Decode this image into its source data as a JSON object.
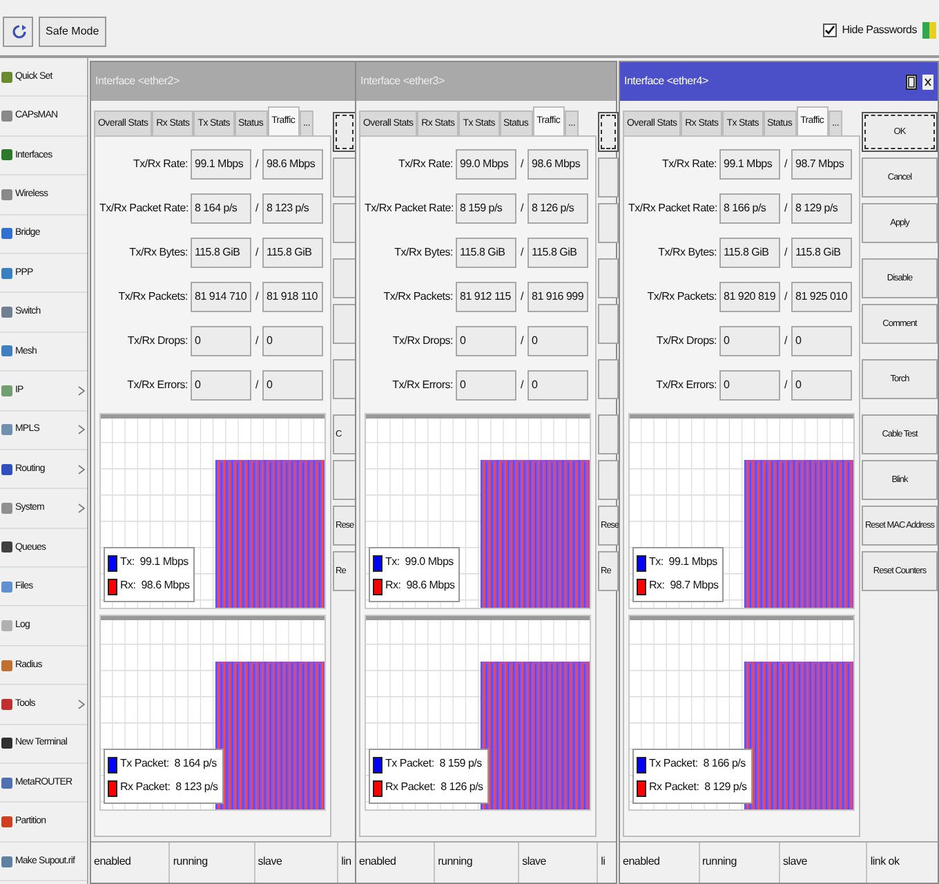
{
  "toolbar": {
    "safe_mode": "Safe Mode",
    "hide_passwords": {
      "label": "Hide Passwords",
      "checked": true
    }
  },
  "sidebar": {
    "items": [
      {
        "label": "Quick Set",
        "submenu": false
      },
      {
        "label": "CAPsMAN",
        "submenu": false
      },
      {
        "label": "Interfaces",
        "submenu": false
      },
      {
        "label": "Wireless",
        "submenu": false
      },
      {
        "label": "Bridge",
        "submenu": false
      },
      {
        "label": "PPP",
        "submenu": false
      },
      {
        "label": "Switch",
        "submenu": false
      },
      {
        "label": "Mesh",
        "submenu": false
      },
      {
        "label": "IP",
        "submenu": true
      },
      {
        "label": "MPLS",
        "submenu": true
      },
      {
        "label": "Routing",
        "submenu": true
      },
      {
        "label": "System",
        "submenu": true
      },
      {
        "label": "Queues",
        "submenu": false
      },
      {
        "label": "Files",
        "submenu": false
      },
      {
        "label": "Log",
        "submenu": false
      },
      {
        "label": "Radius",
        "submenu": false
      },
      {
        "label": "Tools",
        "submenu": true
      },
      {
        "label": "New Terminal",
        "submenu": false
      },
      {
        "label": "MetaROUTER",
        "submenu": false
      },
      {
        "label": "Partition",
        "submenu": false
      },
      {
        "label": "Make Supout.rif",
        "submenu": false
      }
    ]
  },
  "windows": [
    {
      "title": "Interface <ether2>",
      "active": false,
      "tabs": [
        {
          "label": "Overall Stats",
          "selected": false
        },
        {
          "label": "Rx Stats",
          "selected": false
        },
        {
          "label": "Tx Stats",
          "selected": false
        },
        {
          "label": "Status",
          "selected": false
        },
        {
          "label": "Traffic",
          "selected": true
        },
        {
          "label": "...",
          "selected": false
        }
      ],
      "fields": [
        {
          "label": "Tx/Rx Rate:",
          "tx": "99.1 Mbps",
          "separator": "/",
          "rx": "98.6 Mbps"
        },
        {
          "label": "Tx/Rx Packet Rate:",
          "tx": "8 164 p/s",
          "separator": "/",
          "rx": "8 123 p/s"
        },
        {
          "label": "Tx/Rx Bytes:",
          "tx": "115.8 GiB",
          "separator": "/",
          "rx": "115.8 GiB"
        },
        {
          "label": "Tx/Rx Packets:",
          "tx": "81 914 710",
          "separator": "/",
          "rx": "81 918 110"
        },
        {
          "label": "Tx/Rx Drops:",
          "tx": "0",
          "separator": "/",
          "rx": "0"
        },
        {
          "label": "Tx/Rx Errors:",
          "tx": "0",
          "separator": "/",
          "rx": "0"
        }
      ],
      "graphs": [
        {
          "legend": [
            {
              "label": "Tx:  99.1 Mbps",
              "color": "#0000ff"
            },
            {
              "label": "Rx:  98.6 Mbps",
              "color": "#ff0000"
            }
          ]
        },
        {
          "legend": [
            {
              "label": "Tx Packet:  8 164 p/s",
              "color": "#0000ff"
            },
            {
              "label": "Rx Packet:  8 123 p/s",
              "color": "#ff0000"
            }
          ]
        }
      ],
      "button_groups": [
        [
          {
            "focused": true
          },
          {
            "focused": false
          },
          {
            "focused": false
          }
        ],
        [
          {
            "focused": false
          },
          {
            "focused": false
          }
        ],
        [
          {
            "focused": false
          }
        ],
        [
          {
            "label": "C",
            "focused": false
          },
          {
            "focused": false
          },
          {
            "label": "Rese",
            "focused": false
          },
          {
            "label": "Re",
            "focused": false
          }
        ]
      ],
      "status": [
        "enabled",
        "running",
        "slave",
        "lin"
      ]
    },
    {
      "title": "Interface <ether3>",
      "active": false,
      "tabs": [
        {
          "label": "Overall Stats",
          "selected": false
        },
        {
          "label": "Rx Stats",
          "selected": false
        },
        {
          "label": "Tx Stats",
          "selected": false
        },
        {
          "label": "Status",
          "selected": false
        },
        {
          "label": "Traffic",
          "selected": true
        },
        {
          "label": "...",
          "selected": false
        }
      ],
      "fields": [
        {
          "label": "Tx/Rx Rate:",
          "tx": "99.0 Mbps",
          "separator": "/",
          "rx": "98.6 Mbps"
        },
        {
          "label": "Tx/Rx Packet Rate:",
          "tx": "8 159 p/s",
          "separator": "/",
          "rx": "8 126 p/s"
        },
        {
          "label": "Tx/Rx Bytes:",
          "tx": "115.8 GiB",
          "separator": "/",
          "rx": "115.8 GiB"
        },
        {
          "label": "Tx/Rx Packets:",
          "tx": "81 912 115",
          "separator": "/",
          "rx": "81 916 999"
        },
        {
          "label": "Tx/Rx Drops:",
          "tx": "0",
          "separator": "/",
          "rx": "0"
        },
        {
          "label": "Tx/Rx Errors:",
          "tx": "0",
          "separator": "/",
          "rx": "0"
        }
      ],
      "graphs": [
        {
          "legend": [
            {
              "label": "Tx:  99.0 Mbps",
              "color": "#0000ff"
            },
            {
              "label": "Rx:  98.6 Mbps",
              "color": "#ff0000"
            }
          ]
        },
        {
          "legend": [
            {
              "label": "Tx Packet:  8 159 p/s",
              "color": "#0000ff"
            },
            {
              "label": "Rx Packet:  8 126 p/s",
              "color": "#ff0000"
            }
          ]
        }
      ],
      "button_groups": [
        [
          {
            "focused": true
          },
          {
            "focused": false
          },
          {
            "focused": false
          }
        ],
        [
          {
            "focused": false
          },
          {
            "focused": false
          }
        ],
        [
          {
            "focused": false
          }
        ],
        [
          {
            "focused": false
          },
          {
            "focused": false
          },
          {
            "label": "Rese",
            "focused": false
          },
          {
            "label": "Re",
            "focused": false
          }
        ]
      ],
      "status": [
        "enabled",
        "running",
        "slave",
        "li"
      ]
    },
    {
      "title": "Interface <ether4>",
      "active": true,
      "tabs": [
        {
          "label": "Overall Stats",
          "selected": false
        },
        {
          "label": "Rx Stats",
          "selected": false
        },
        {
          "label": "Tx Stats",
          "selected": false
        },
        {
          "label": "Status",
          "selected": false
        },
        {
          "label": "Traffic",
          "selected": true
        },
        {
          "label": "...",
          "selected": false
        }
      ],
      "fields": [
        {
          "label": "Tx/Rx Rate:",
          "tx": "99.1 Mbps",
          "separator": "/",
          "rx": "98.7 Mbps"
        },
        {
          "label": "Tx/Rx Packet Rate:",
          "tx": "8 166 p/s",
          "separator": "/",
          "rx": "8 129 p/s"
        },
        {
          "label": "Tx/Rx Bytes:",
          "tx": "115.8 GiB",
          "separator": "/",
          "rx": "115.8 GiB"
        },
        {
          "label": "Tx/Rx Packets:",
          "tx": "81 920 819",
          "separator": "/",
          "rx": "81 925 010"
        },
        {
          "label": "Tx/Rx Drops:",
          "tx": "0",
          "separator": "/",
          "rx": "0"
        },
        {
          "label": "Tx/Rx Errors:",
          "tx": "0",
          "separator": "/",
          "rx": "0"
        }
      ],
      "graphs": [
        {
          "legend": [
            {
              "label": "Tx:  99.1 Mbps",
              "color": "#0000ff"
            },
            {
              "label": "Rx:  98.7 Mbps",
              "color": "#ff0000"
            }
          ]
        },
        {
          "legend": [
            {
              "label": "Tx Packet:  8 166 p/s",
              "color": "#0000ff"
            },
            {
              "label": "Rx Packet:  8 129 p/s",
              "color": "#ff0000"
            }
          ]
        }
      ],
      "button_groups": [
        [
          {
            "label": "OK",
            "focused": true
          },
          {
            "label": "Cancel",
            "focused": false
          },
          {
            "label": "Apply",
            "focused": false
          }
        ],
        [
          {
            "label": "Disable",
            "focused": false
          },
          {
            "label": "Comment",
            "focused": false
          }
        ],
        [
          {
            "label": "Torch",
            "focused": false
          }
        ],
        [
          {
            "label": "Cable Test",
            "focused": false
          },
          {
            "label": "Blink",
            "focused": false
          },
          {
            "label": "Reset MAC Address",
            "focused": false
          },
          {
            "label": "Reset Counters",
            "focused": false
          }
        ]
      ],
      "status": [
        "enabled",
        "running",
        "slave",
        "link ok"
      ]
    }
  ]
}
